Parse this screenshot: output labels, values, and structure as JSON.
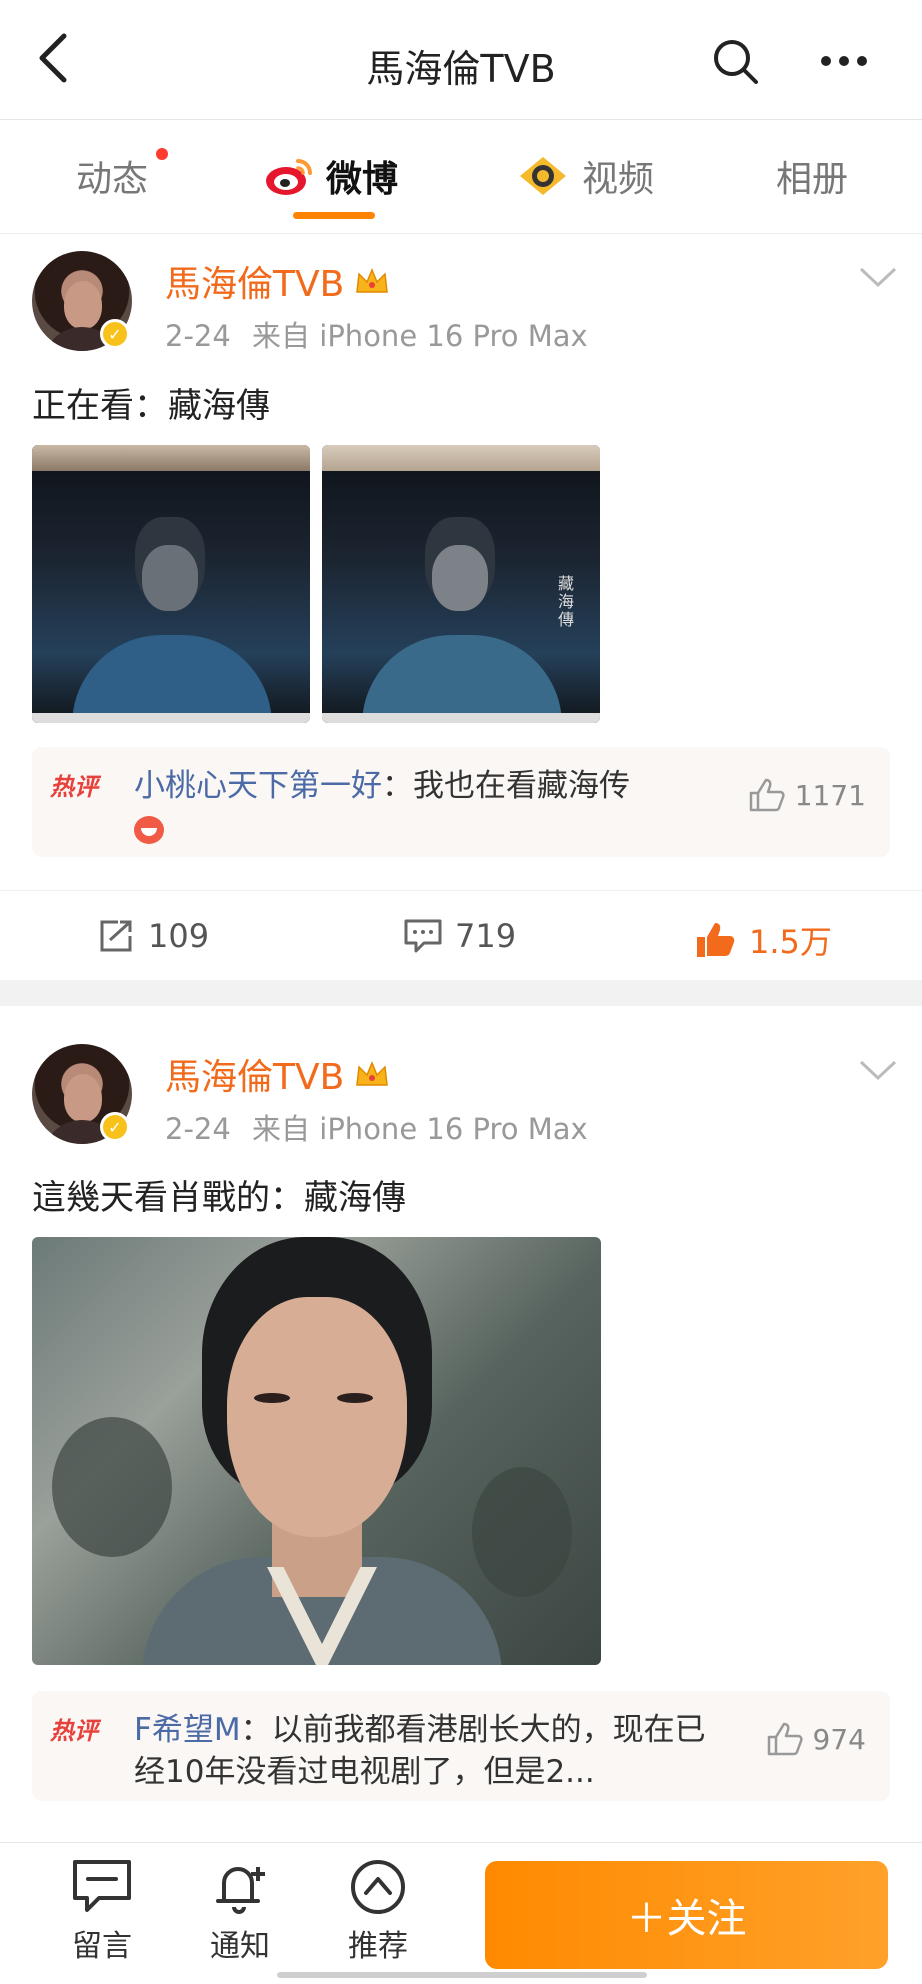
{
  "header": {
    "title": "馬海倫TVB"
  },
  "tabs": [
    {
      "label": "动态"
    },
    {
      "label": "微博"
    },
    {
      "label": "视频"
    },
    {
      "label": "相册"
    }
  ],
  "posts": [
    {
      "username": "馬海倫TVB",
      "date": "2-24",
      "source": "来自 iPhone 16 Pro Max",
      "text": "正在看：藏海傳",
      "image_caption_text": "藏海傳",
      "hot_comment": {
        "badge": "热评",
        "user": "小桃心天下第一好",
        "text": "：我也在看藏海传",
        "likes": "1171"
      },
      "reposts": "109",
      "comments": "719",
      "likes": "1.5万"
    },
    {
      "username": "馬海倫TVB",
      "date": "2-24",
      "source": "来自 iPhone 16 Pro Max",
      "text": "這幾天看肖戰的：藏海傳",
      "hot_comment": {
        "badge": "热评",
        "user": "F希望M",
        "text": "：以前我都看港剧长大的，现在已经10年没看过电视剧了，但是2...",
        "likes": "974"
      }
    }
  ],
  "bottom_bar": {
    "items": [
      {
        "label": "留言",
        "icon": "message-icon"
      },
      {
        "label": "通知",
        "icon": "bell-plus-icon"
      },
      {
        "label": "推荐",
        "icon": "recommend-icon"
      }
    ],
    "follow_label": "＋关注"
  },
  "colors": {
    "accent": "#ff8200",
    "username": "#f26b1d",
    "hot_badge": "#e8413c",
    "liked": "#f26b1d"
  }
}
